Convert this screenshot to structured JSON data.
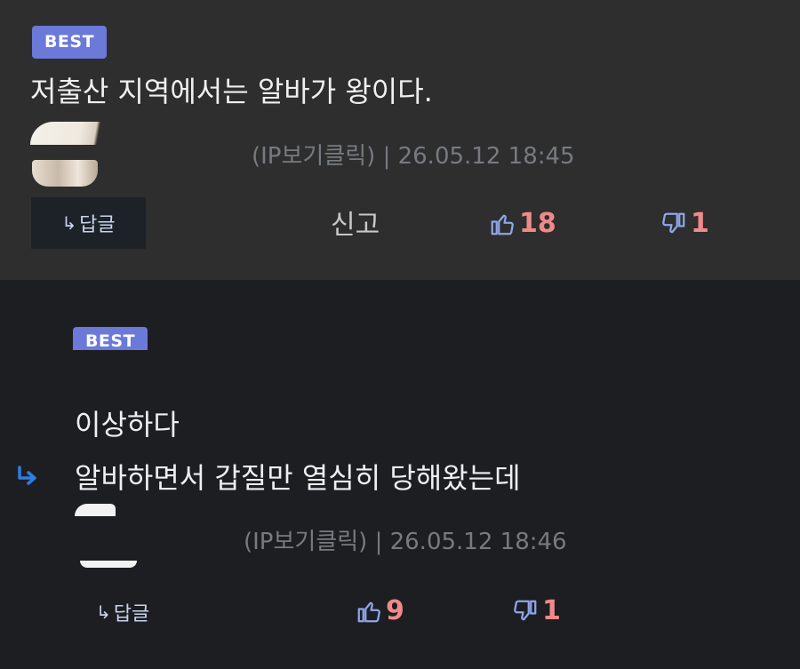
{
  "comments": [
    {
      "badge": "BEST",
      "lines": [
        "저출산 지역에서는 알바가 왕이다."
      ],
      "meta": "(IP보기클릭) | 26.05.12 18:45",
      "reply_label": "답글",
      "report_label": "신고",
      "likes": "18",
      "dislikes": "1"
    },
    {
      "badge": "BEST",
      "lines": [
        "이상하다",
        "알바하면서 갑질만 열심히 당해왔는데"
      ],
      "meta": "(IP보기클릭) | 26.05.12 18:46",
      "reply_label": "답글",
      "likes": "9",
      "dislikes": "1"
    }
  ],
  "colors": {
    "badge": "#6b79d9",
    "vote": "#f08a8a",
    "icon_blue": "#8fa6e8",
    "reply_arrow": "#2f7de1"
  },
  "icons": [
    "thumbs-up-icon",
    "thumbs-down-icon",
    "reply-arrow-icon"
  ]
}
